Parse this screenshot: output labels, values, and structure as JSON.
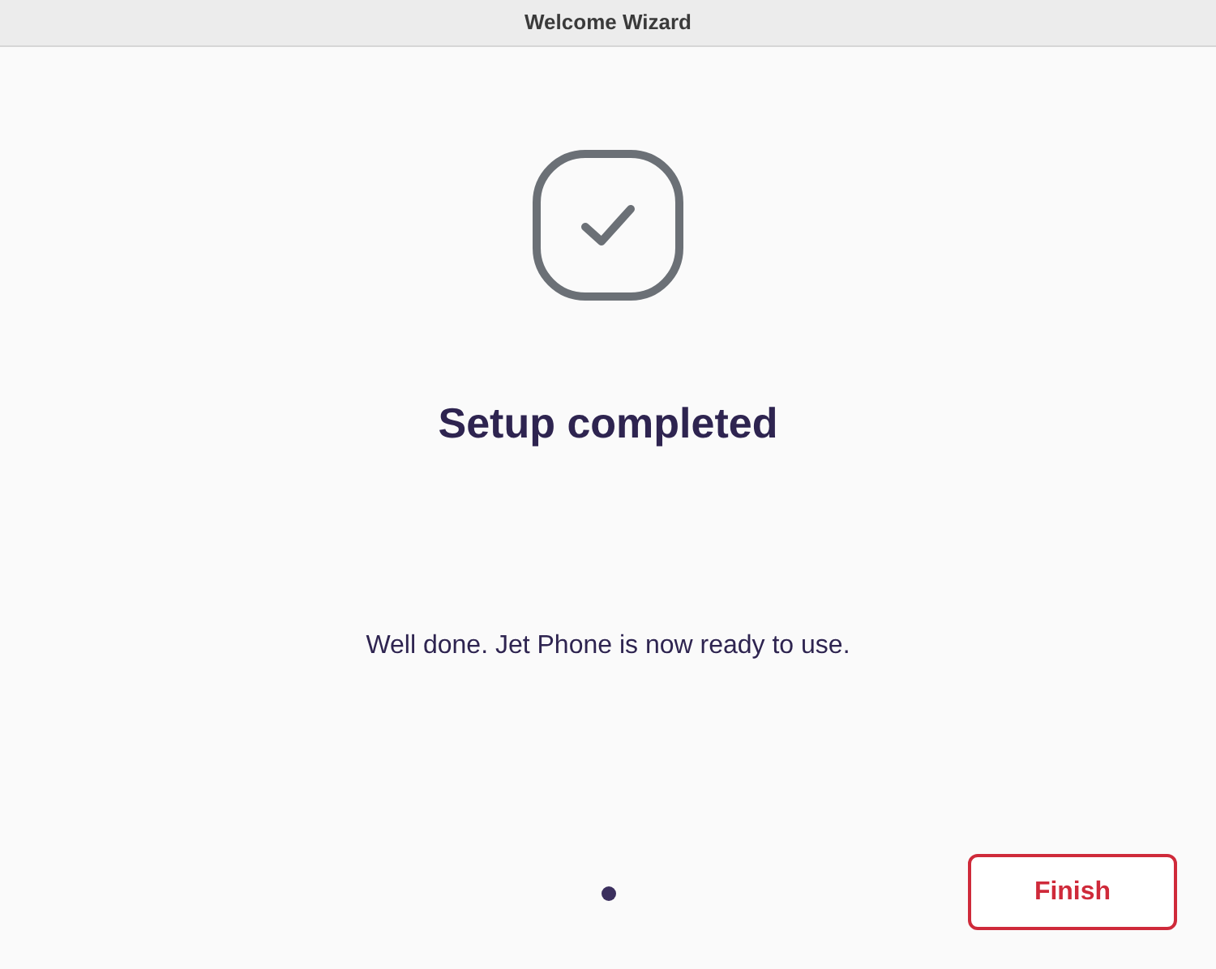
{
  "window": {
    "title": "Welcome Wizard"
  },
  "heading": "Setup completed",
  "message": "Well done. Jet Phone is now ready to use.",
  "pages": [
    {
      "selected": true
    }
  ],
  "buttons": [
    {
      "label": "Finish"
    }
  ]
}
